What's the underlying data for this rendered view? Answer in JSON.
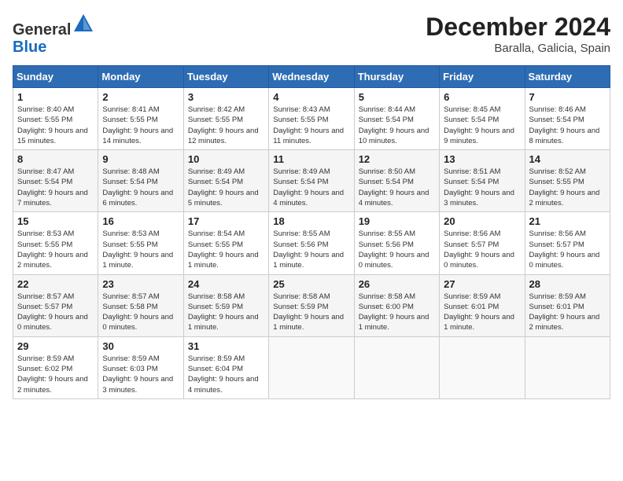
{
  "header": {
    "logo_line1": "General",
    "logo_line2": "Blue",
    "title": "December 2024",
    "subtitle": "Baralla, Galicia, Spain"
  },
  "calendar": {
    "days_of_week": [
      "Sunday",
      "Monday",
      "Tuesday",
      "Wednesday",
      "Thursday",
      "Friday",
      "Saturday"
    ],
    "weeks": [
      [
        {
          "day": "1",
          "info": "Sunrise: 8:40 AM\nSunset: 5:55 PM\nDaylight: 9 hours and 15 minutes."
        },
        {
          "day": "2",
          "info": "Sunrise: 8:41 AM\nSunset: 5:55 PM\nDaylight: 9 hours and 14 minutes."
        },
        {
          "day": "3",
          "info": "Sunrise: 8:42 AM\nSunset: 5:55 PM\nDaylight: 9 hours and 12 minutes."
        },
        {
          "day": "4",
          "info": "Sunrise: 8:43 AM\nSunset: 5:55 PM\nDaylight: 9 hours and 11 minutes."
        },
        {
          "day": "5",
          "info": "Sunrise: 8:44 AM\nSunset: 5:54 PM\nDaylight: 9 hours and 10 minutes."
        },
        {
          "day": "6",
          "info": "Sunrise: 8:45 AM\nSunset: 5:54 PM\nDaylight: 9 hours and 9 minutes."
        },
        {
          "day": "7",
          "info": "Sunrise: 8:46 AM\nSunset: 5:54 PM\nDaylight: 9 hours and 8 minutes."
        }
      ],
      [
        {
          "day": "8",
          "info": "Sunrise: 8:47 AM\nSunset: 5:54 PM\nDaylight: 9 hours and 7 minutes."
        },
        {
          "day": "9",
          "info": "Sunrise: 8:48 AM\nSunset: 5:54 PM\nDaylight: 9 hours and 6 minutes."
        },
        {
          "day": "10",
          "info": "Sunrise: 8:49 AM\nSunset: 5:54 PM\nDaylight: 9 hours and 5 minutes."
        },
        {
          "day": "11",
          "info": "Sunrise: 8:49 AM\nSunset: 5:54 PM\nDaylight: 9 hours and 4 minutes."
        },
        {
          "day": "12",
          "info": "Sunrise: 8:50 AM\nSunset: 5:54 PM\nDaylight: 9 hours and 4 minutes."
        },
        {
          "day": "13",
          "info": "Sunrise: 8:51 AM\nSunset: 5:54 PM\nDaylight: 9 hours and 3 minutes."
        },
        {
          "day": "14",
          "info": "Sunrise: 8:52 AM\nSunset: 5:55 PM\nDaylight: 9 hours and 2 minutes."
        }
      ],
      [
        {
          "day": "15",
          "info": "Sunrise: 8:53 AM\nSunset: 5:55 PM\nDaylight: 9 hours and 2 minutes."
        },
        {
          "day": "16",
          "info": "Sunrise: 8:53 AM\nSunset: 5:55 PM\nDaylight: 9 hours and 1 minute."
        },
        {
          "day": "17",
          "info": "Sunrise: 8:54 AM\nSunset: 5:55 PM\nDaylight: 9 hours and 1 minute."
        },
        {
          "day": "18",
          "info": "Sunrise: 8:55 AM\nSunset: 5:56 PM\nDaylight: 9 hours and 1 minute."
        },
        {
          "day": "19",
          "info": "Sunrise: 8:55 AM\nSunset: 5:56 PM\nDaylight: 9 hours and 0 minutes."
        },
        {
          "day": "20",
          "info": "Sunrise: 8:56 AM\nSunset: 5:57 PM\nDaylight: 9 hours and 0 minutes."
        },
        {
          "day": "21",
          "info": "Sunrise: 8:56 AM\nSunset: 5:57 PM\nDaylight: 9 hours and 0 minutes."
        }
      ],
      [
        {
          "day": "22",
          "info": "Sunrise: 8:57 AM\nSunset: 5:57 PM\nDaylight: 9 hours and 0 minutes."
        },
        {
          "day": "23",
          "info": "Sunrise: 8:57 AM\nSunset: 5:58 PM\nDaylight: 9 hours and 0 minutes."
        },
        {
          "day": "24",
          "info": "Sunrise: 8:58 AM\nSunset: 5:59 PM\nDaylight: 9 hours and 1 minute."
        },
        {
          "day": "25",
          "info": "Sunrise: 8:58 AM\nSunset: 5:59 PM\nDaylight: 9 hours and 1 minute."
        },
        {
          "day": "26",
          "info": "Sunrise: 8:58 AM\nSunset: 6:00 PM\nDaylight: 9 hours and 1 minute."
        },
        {
          "day": "27",
          "info": "Sunrise: 8:59 AM\nSunset: 6:01 PM\nDaylight: 9 hours and 1 minute."
        },
        {
          "day": "28",
          "info": "Sunrise: 8:59 AM\nSunset: 6:01 PM\nDaylight: 9 hours and 2 minutes."
        }
      ],
      [
        {
          "day": "29",
          "info": "Sunrise: 8:59 AM\nSunset: 6:02 PM\nDaylight: 9 hours and 2 minutes."
        },
        {
          "day": "30",
          "info": "Sunrise: 8:59 AM\nSunset: 6:03 PM\nDaylight: 9 hours and 3 minutes."
        },
        {
          "day": "31",
          "info": "Sunrise: 8:59 AM\nSunset: 6:04 PM\nDaylight: 9 hours and 4 minutes."
        },
        {
          "day": "",
          "info": ""
        },
        {
          "day": "",
          "info": ""
        },
        {
          "day": "",
          "info": ""
        },
        {
          "day": "",
          "info": ""
        }
      ]
    ]
  }
}
